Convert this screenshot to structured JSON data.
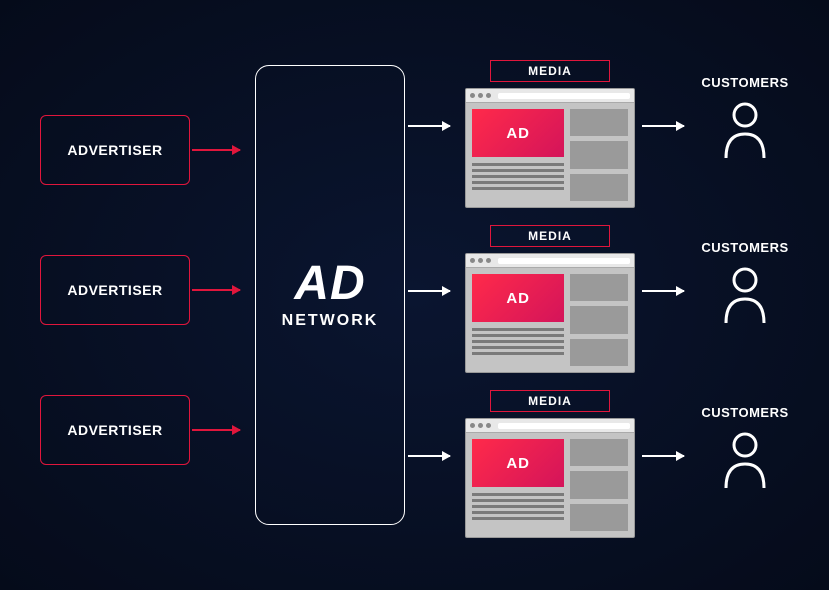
{
  "advertisers": [
    {
      "label": "ADVERTISER"
    },
    {
      "label": "ADVERTISER"
    },
    {
      "label": "ADVERTISER"
    }
  ],
  "network": {
    "title": "AD",
    "subtitle": "NETWORK"
  },
  "media": [
    {
      "label": "MEDIA",
      "ad_label": "AD"
    },
    {
      "label": "MEDIA",
      "ad_label": "AD"
    },
    {
      "label": "MEDIA",
      "ad_label": "AD"
    }
  ],
  "customers": [
    {
      "label": "CUSTOMERS"
    },
    {
      "label": "CUSTOMERS"
    },
    {
      "label": "CUSTOMERS"
    }
  ],
  "colors": {
    "accent_red": "#e0163c",
    "ad_gradient_start": "#ff2a4a",
    "ad_gradient_end": "#d4145a",
    "background": "#050b1a"
  }
}
